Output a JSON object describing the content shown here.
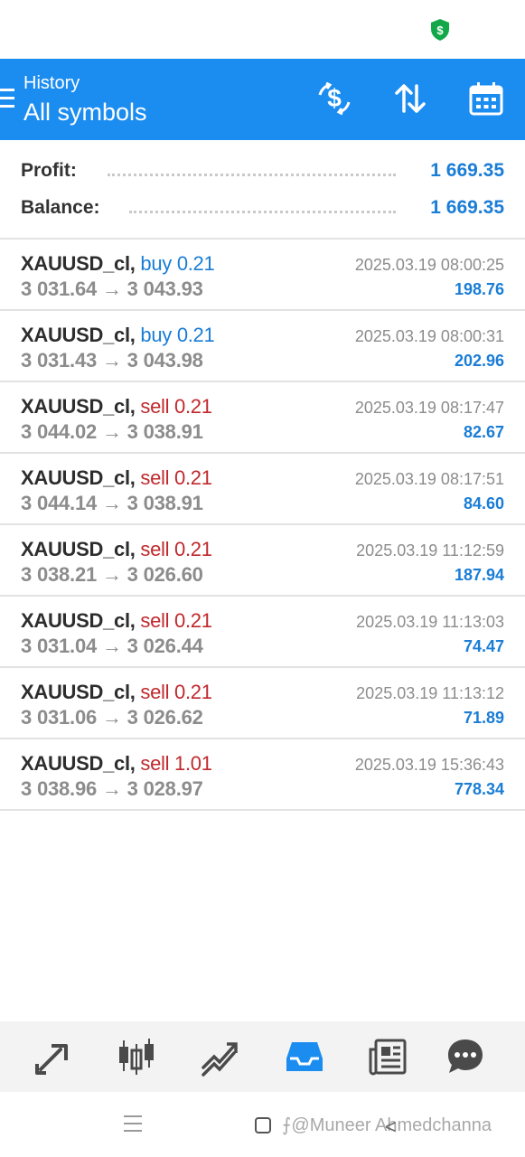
{
  "status_bar": {
    "shield_icon": "dollar-shield-icon",
    "shield_color": "#12a84a"
  },
  "header": {
    "subtitle": "History",
    "title": "All symbols",
    "background": "#1c8df0",
    "actions": [
      "currency-exchange-icon",
      "sort-icon",
      "calendar-icon"
    ]
  },
  "summary": {
    "profit_label": "Profit:",
    "profit_value": "1 669.35",
    "balance_label": "Balance:",
    "balance_value": "1 669.35"
  },
  "deals": [
    {
      "symbol": "XAUUSD_cl,",
      "type": "buy",
      "volume": "0.21",
      "prices": "3 031.64 → 3 043.93",
      "time": "2025.03.19 08:00:25",
      "profit": "198.76"
    },
    {
      "symbol": "XAUUSD_cl,",
      "type": "buy",
      "volume": "0.21",
      "prices": "3 031.43 → 3 043.98",
      "time": "2025.03.19 08:00:31",
      "profit": "202.96"
    },
    {
      "symbol": "XAUUSD_cl,",
      "type": "sell",
      "volume": "0.21",
      "prices": "3 044.02 → 3 038.91",
      "time": "2025.03.19 08:17:47",
      "profit": "82.67"
    },
    {
      "symbol": "XAUUSD_cl,",
      "type": "sell",
      "volume": "0.21",
      "prices": "3 044.14 → 3 038.91",
      "time": "2025.03.19 08:17:51",
      "profit": "84.60"
    },
    {
      "symbol": "XAUUSD_cl,",
      "type": "sell",
      "volume": "0.21",
      "prices": "3 038.21 → 3 026.60",
      "time": "2025.03.19 11:12:59",
      "profit": "187.94"
    },
    {
      "symbol": "XAUUSD_cl,",
      "type": "sell",
      "volume": "0.21",
      "prices": "3 031.04 → 3 026.44",
      "time": "2025.03.19 11:13:03",
      "profit": "74.47"
    },
    {
      "symbol": "XAUUSD_cl,",
      "type": "sell",
      "volume": "0.21",
      "prices": "3 031.06 → 3 026.62",
      "time": "2025.03.19 11:13:12",
      "profit": "71.89"
    },
    {
      "symbol": "XAUUSD_cl,",
      "type": "sell",
      "volume": "1.01",
      "prices": "3 038.96 → 3 028.97",
      "time": "2025.03.19 15:36:43",
      "profit": "778.34"
    }
  ],
  "colors": {
    "buy": "#1a7dd6",
    "sell": "#c0282c",
    "profit": "#1a7dd6",
    "nav_active": "#1c8df0",
    "nav_inactive": "#4a4a4a"
  },
  "bottom_nav": {
    "items": [
      "quotes-icon",
      "chart-icon",
      "trade-icon",
      "history-icon",
      "news-icon",
      "chat-icon"
    ],
    "active": "history-icon"
  },
  "system_nav": {
    "watermark": "⨍@Muneer Ahmedchanna"
  }
}
